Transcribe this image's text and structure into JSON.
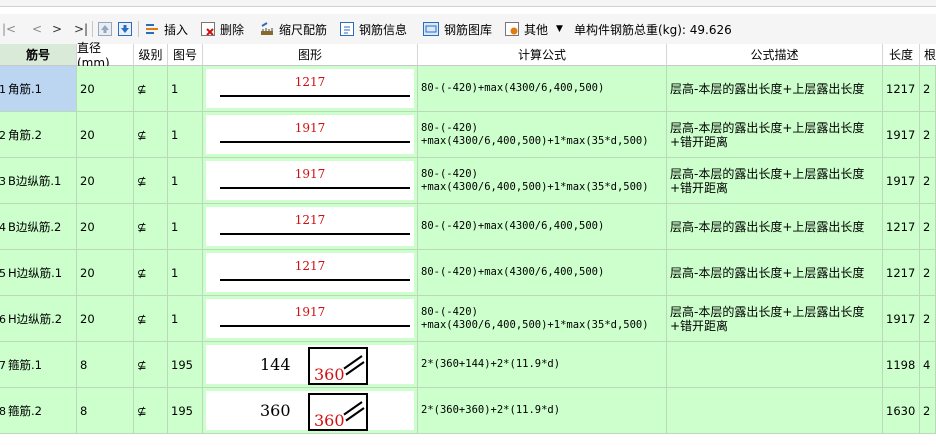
{
  "toolbar": {
    "nav_first": "|<",
    "nav_prev": "<",
    "nav_next": ">",
    "nav_last": ">|",
    "insert": "插入",
    "delete": "删除",
    "scale_rebar": "缩尺配筋",
    "rebar_info": "钢筋信息",
    "rebar_library": "钢筋图库",
    "other": "其他",
    "total_label": "单构件钢筋总重(kg): 49.626"
  },
  "headers": {
    "name": "筋号",
    "diameter": "直径(mm)",
    "grade": "级别",
    "fig_no": "图号",
    "shape": "图形",
    "formula": "计算公式",
    "description": "公式描述",
    "length": "长度",
    "count": "根"
  },
  "rows": [
    {
      "num": "1",
      "name": "角筋.1",
      "diameter": "20",
      "grade": "⊈",
      "fig": "1",
      "shape_type": "bar",
      "shape_value": "1217",
      "formula": "80-(-420)+max(4300/6,400,500)",
      "description": "层高-本层的露出长度+上层露出长度",
      "length": "1217",
      "count": "2"
    },
    {
      "num": "2",
      "name": "角筋.2",
      "diameter": "20",
      "grade": "⊈",
      "fig": "1",
      "shape_type": "bar",
      "shape_value": "1917",
      "formula": "80-(-420) +max(4300/6,400,500)+1*max(35*d,500)",
      "description": "层高-本层的露出长度+上层露出长度+错开距离",
      "length": "1917",
      "count": "2"
    },
    {
      "num": "3",
      "name": "B边纵筋.1",
      "diameter": "20",
      "grade": "⊈",
      "fig": "1",
      "shape_type": "bar",
      "shape_value": "1917",
      "formula": "80-(-420) +max(4300/6,400,500)+1*max(35*d,500)",
      "description": "层高-本层的露出长度+上层露出长度+错开距离",
      "length": "1917",
      "count": "2"
    },
    {
      "num": "4",
      "name": "B边纵筋.2",
      "diameter": "20",
      "grade": "⊈",
      "fig": "1",
      "shape_type": "bar",
      "shape_value": "1217",
      "formula": "80-(-420)+max(4300/6,400,500)",
      "description": "层高-本层的露出长度+上层露出长度",
      "length": "1217",
      "count": "2"
    },
    {
      "num": "5",
      "name": "H边纵筋.1",
      "diameter": "20",
      "grade": "⊈",
      "fig": "1",
      "shape_type": "bar",
      "shape_value": "1217",
      "formula": "80-(-420)+max(4300/6,400,500)",
      "description": "层高-本层的露出长度+上层露出长度",
      "length": "1217",
      "count": "2"
    },
    {
      "num": "6",
      "name": "H边纵筋.2",
      "diameter": "20",
      "grade": "⊈",
      "fig": "1",
      "shape_type": "bar",
      "shape_value": "1917",
      "formula": "80-(-420) +max(4300/6,400,500)+1*max(35*d,500)",
      "description": "层高-本层的露出长度+上层露出长度+错开距离",
      "length": "1917",
      "count": "2"
    },
    {
      "num": "7",
      "name": "箍筋.1",
      "diameter": "8",
      "grade": "⊈",
      "fig": "195",
      "shape_type": "stirrup",
      "shape_value": "144",
      "shape_value2": "360",
      "formula": "2*(360+144)+2*(11.9*d)",
      "description": "",
      "length": "1198",
      "count": "4"
    },
    {
      "num": "8",
      "name": "箍筋.2",
      "diameter": "8",
      "grade": "⊈",
      "fig": "195",
      "shape_type": "stirrup",
      "shape_value": "360",
      "shape_value2": "360",
      "formula": "2*(360+360)+2*(11.9*d)",
      "description": "",
      "length": "1630",
      "count": "2"
    }
  ]
}
